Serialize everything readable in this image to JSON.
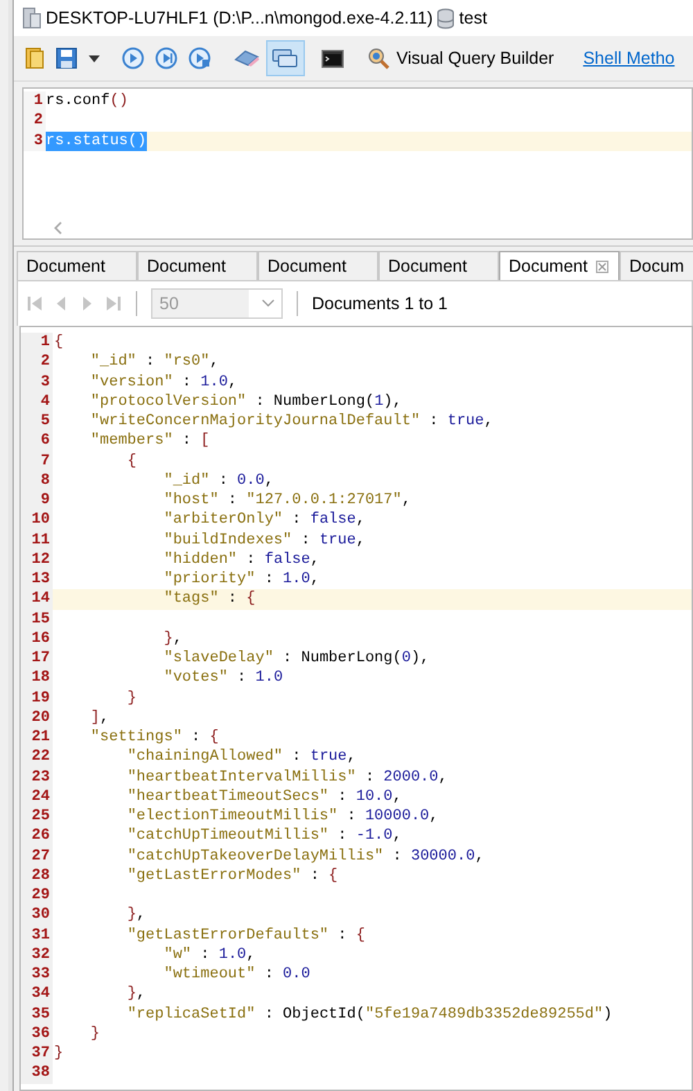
{
  "window": {
    "connection": "DESKTOP-LU7HLF1 (D:\\P...n\\mongod.exe-4.2.11)",
    "database": "test"
  },
  "toolbar": {
    "buttons": [
      {
        "kind": "folder",
        "pressed": false
      },
      {
        "kind": "save",
        "pressed": false
      },
      {
        "kind": "dropdown",
        "pressed": false
      },
      {
        "kind": "run",
        "pressed": false
      },
      {
        "kind": "run-line",
        "pressed": false
      },
      {
        "kind": "run-lock",
        "pressed": false
      },
      {
        "kind": "eraser",
        "pressed": false
      },
      {
        "kind": "windows",
        "pressed": true
      },
      {
        "kind": "terminal",
        "pressed": false
      }
    ],
    "query_builder": "Visual Query Builder",
    "shell_link": "Shell Metho"
  },
  "editor": {
    "lines": [
      {
        "number": "1",
        "text": "rs.conf()",
        "selected": false,
        "current": false
      },
      {
        "number": "2",
        "current": false
      },
      {
        "number": "3",
        "text": "rs.status()",
        "selected": true,
        "current": true
      }
    ]
  },
  "result_tabs": [
    {
      "label": "Document",
      "selected": false
    },
    {
      "label": "Document",
      "selected": false
    },
    {
      "label": "Document",
      "selected": false
    },
    {
      "label": "Document",
      "selected": false
    },
    {
      "label": "Document",
      "selected": true
    },
    {
      "label": "Docum",
      "selected": false
    }
  ],
  "pager": {
    "nav": [
      {
        "kind": "first",
        "disabled": true
      },
      {
        "kind": "prev",
        "disabled": true
      },
      {
        "kind": "next",
        "disabled": true
      },
      {
        "kind": "last",
        "disabled": true
      }
    ],
    "page_size": "50",
    "summary": "Documents 1 to 1"
  },
  "results": {
    "lines": [
      {
        "number": "1",
        "text": "{",
        "current": false
      },
      {
        "number": "2",
        "text": "    \"_id\" : \"rs0\",",
        "current": false
      },
      {
        "number": "3",
        "text": "    \"version\" : 1.0,",
        "current": false
      },
      {
        "number": "4",
        "text": "    \"protocolVersion\" : NumberLong(1),",
        "current": false
      },
      {
        "number": "5",
        "text": "    \"writeConcernMajorityJournalDefault\" : true,",
        "current": false
      },
      {
        "number": "6",
        "text": "    \"members\" : [",
        "current": false
      },
      {
        "number": "7",
        "text": "        {",
        "current": false
      },
      {
        "number": "8",
        "text": "            \"_id\" : 0.0,",
        "current": false
      },
      {
        "number": "9",
        "text": "            \"host\" : \"127.0.0.1:27017\",",
        "current": false
      },
      {
        "number": "10",
        "text": "            \"arbiterOnly\" : false,",
        "current": false
      },
      {
        "number": "11",
        "text": "            \"buildIndexes\" : true,",
        "current": false
      },
      {
        "number": "12",
        "text": "            \"hidden\" : false,",
        "current": false
      },
      {
        "number": "13",
        "text": "            \"priority\" : 1.0,",
        "current": false
      },
      {
        "number": "14",
        "text": "            \"tags\" : {",
        "current": true
      },
      {
        "number": "15",
        "current": false
      },
      {
        "number": "16",
        "text": "            },",
        "current": false
      },
      {
        "number": "17",
        "text": "            \"slaveDelay\" : NumberLong(0),",
        "current": false
      },
      {
        "number": "18",
        "text": "            \"votes\" : 1.0",
        "current": false
      },
      {
        "number": "19",
        "text": "        }",
        "current": false
      },
      {
        "number": "20",
        "text": "    ],",
        "current": false
      },
      {
        "number": "21",
        "text": "    \"settings\" : {",
        "current": false
      },
      {
        "number": "22",
        "text": "        \"chainingAllowed\" : true,",
        "current": false
      },
      {
        "number": "23",
        "text": "        \"heartbeatIntervalMillis\" : 2000.0,",
        "current": false
      },
      {
        "number": "24",
        "text": "        \"heartbeatTimeoutSecs\" : 10.0,",
        "current": false
      },
      {
        "number": "25",
        "text": "        \"electionTimeoutMillis\" : 10000.0,",
        "current": false
      },
      {
        "number": "26",
        "text": "        \"catchUpTimeoutMillis\" : -1.0,",
        "current": false
      },
      {
        "number": "27",
        "text": "        \"catchUpTakeoverDelayMillis\" : 30000.0,",
        "current": false
      },
      {
        "number": "28",
        "text": "        \"getLastErrorModes\" : {",
        "current": false
      },
      {
        "number": "29",
        "current": false
      },
      {
        "number": "30",
        "text": "        },",
        "current": false
      },
      {
        "number": "31",
        "text": "        \"getLastErrorDefaults\" : {",
        "current": false
      },
      {
        "number": "32",
        "text": "            \"w\" : 1.0,",
        "current": false
      },
      {
        "number": "33",
        "text": "            \"wtimeout\" : 0.0",
        "current": false
      },
      {
        "number": "34",
        "text": "        },",
        "current": false
      },
      {
        "number": "35",
        "text": "        \"replicaSetId\" : ObjectId(\"5fe19a7489db3352de89255d\")",
        "current": false
      },
      {
        "number": "36",
        "text": "    }",
        "current": false
      },
      {
        "number": "37",
        "text": "}",
        "current": false
      },
      {
        "number": "38",
        "current": false
      }
    ]
  }
}
